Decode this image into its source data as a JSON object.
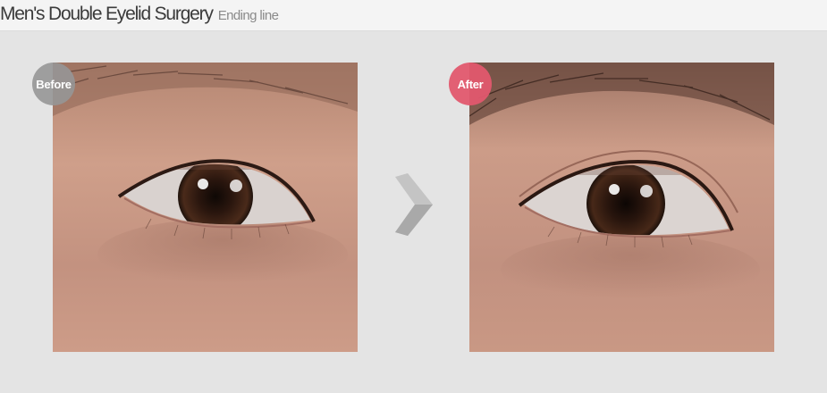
{
  "header": {
    "title": "Men's Double Eyelid Surgery",
    "subtitle": "Ending line"
  },
  "comparison": {
    "before": {
      "badge": "Before"
    },
    "after": {
      "badge": "After"
    }
  },
  "colors": {
    "page_background": "#e4e4e4",
    "header_background": "#f4f4f4",
    "before_badge": "#969696",
    "after_badge": "#e2586e",
    "arrow": "#b9b9b9",
    "skin": "#c99a86"
  },
  "icons": {
    "transition": "chevron-right-icon"
  }
}
